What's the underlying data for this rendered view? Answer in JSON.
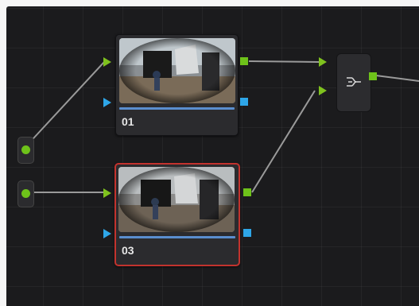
{
  "nodes": [
    {
      "label": "01",
      "selected": false
    },
    {
      "label": "03",
      "selected": true
    }
  ],
  "mixer": {
    "icon": "parallel-mixer-icon"
  },
  "sources": [
    {
      "icon": "source-input-dot"
    },
    {
      "icon": "source-input-dot"
    }
  ],
  "colors": {
    "rgb_port": "#6ec21a",
    "key_port": "#2ea6e8",
    "selected_border": "#c2332e",
    "canvas_bg": "#1b1b1d"
  }
}
